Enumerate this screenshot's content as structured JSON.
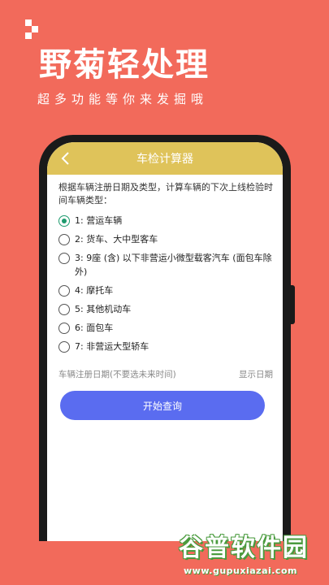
{
  "promo": {
    "headline": "野菊轻处理",
    "subline": "超多功能等你来发掘哦"
  },
  "app": {
    "title": "车检计算器",
    "description": "根据车辆注册日期及类型，计算车辆的下次上线检验时间车辆类型：",
    "vehicle_types": [
      {
        "label": "1: 营运车辆",
        "checked": true
      },
      {
        "label": "2: 货车、大中型客车",
        "checked": false
      },
      {
        "label": "3: 9座 (含) 以下非营运小微型载客汽车 (面包车除外)",
        "checked": false
      },
      {
        "label": "4: 摩托车",
        "checked": false
      },
      {
        "label": "5: 其他机动车",
        "checked": false
      },
      {
        "label": "6: 面包车",
        "checked": false
      },
      {
        "label": "7: 非营运大型轿车",
        "checked": false
      }
    ],
    "register_date_placeholder": "车辆注册日期(不要选未来时间)",
    "show_date_label": "显示日期",
    "query_button": "开始查询"
  },
  "watermark": {
    "name": "谷普软件园",
    "url": "www.gupuxiazai.com"
  },
  "colors": {
    "background": "#f26a5b",
    "topbar": "#dfc35a",
    "button": "#5a6cf0",
    "radio_checked": "#1e9b6e"
  }
}
